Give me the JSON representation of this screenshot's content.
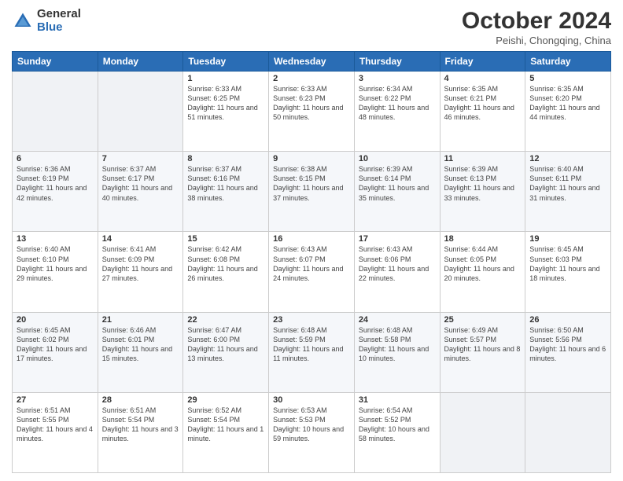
{
  "logo": {
    "general": "General",
    "blue": "Blue"
  },
  "header": {
    "month": "October 2024",
    "location": "Peishi, Chongqing, China"
  },
  "days_of_week": [
    "Sunday",
    "Monday",
    "Tuesday",
    "Wednesday",
    "Thursday",
    "Friday",
    "Saturday"
  ],
  "weeks": [
    [
      {
        "day": "",
        "empty": true
      },
      {
        "day": "",
        "empty": true
      },
      {
        "day": "1",
        "sunrise": "6:33 AM",
        "sunset": "6:25 PM",
        "daylight": "11 hours and 51 minutes."
      },
      {
        "day": "2",
        "sunrise": "6:33 AM",
        "sunset": "6:23 PM",
        "daylight": "11 hours and 50 minutes."
      },
      {
        "day": "3",
        "sunrise": "6:34 AM",
        "sunset": "6:22 PM",
        "daylight": "11 hours and 48 minutes."
      },
      {
        "day": "4",
        "sunrise": "6:35 AM",
        "sunset": "6:21 PM",
        "daylight": "11 hours and 46 minutes."
      },
      {
        "day": "5",
        "sunrise": "6:35 AM",
        "sunset": "6:20 PM",
        "daylight": "11 hours and 44 minutes."
      }
    ],
    [
      {
        "day": "6",
        "sunrise": "6:36 AM",
        "sunset": "6:19 PM",
        "daylight": "11 hours and 42 minutes."
      },
      {
        "day": "7",
        "sunrise": "6:37 AM",
        "sunset": "6:17 PM",
        "daylight": "11 hours and 40 minutes."
      },
      {
        "day": "8",
        "sunrise": "6:37 AM",
        "sunset": "6:16 PM",
        "daylight": "11 hours and 38 minutes."
      },
      {
        "day": "9",
        "sunrise": "6:38 AM",
        "sunset": "6:15 PM",
        "daylight": "11 hours and 37 minutes."
      },
      {
        "day": "10",
        "sunrise": "6:39 AM",
        "sunset": "6:14 PM",
        "daylight": "11 hours and 35 minutes."
      },
      {
        "day": "11",
        "sunrise": "6:39 AM",
        "sunset": "6:13 PM",
        "daylight": "11 hours and 33 minutes."
      },
      {
        "day": "12",
        "sunrise": "6:40 AM",
        "sunset": "6:11 PM",
        "daylight": "11 hours and 31 minutes."
      }
    ],
    [
      {
        "day": "13",
        "sunrise": "6:40 AM",
        "sunset": "6:10 PM",
        "daylight": "11 hours and 29 minutes."
      },
      {
        "day": "14",
        "sunrise": "6:41 AM",
        "sunset": "6:09 PM",
        "daylight": "11 hours and 27 minutes."
      },
      {
        "day": "15",
        "sunrise": "6:42 AM",
        "sunset": "6:08 PM",
        "daylight": "11 hours and 26 minutes."
      },
      {
        "day": "16",
        "sunrise": "6:43 AM",
        "sunset": "6:07 PM",
        "daylight": "11 hours and 24 minutes."
      },
      {
        "day": "17",
        "sunrise": "6:43 AM",
        "sunset": "6:06 PM",
        "daylight": "11 hours and 22 minutes."
      },
      {
        "day": "18",
        "sunrise": "6:44 AM",
        "sunset": "6:05 PM",
        "daylight": "11 hours and 20 minutes."
      },
      {
        "day": "19",
        "sunrise": "6:45 AM",
        "sunset": "6:03 PM",
        "daylight": "11 hours and 18 minutes."
      }
    ],
    [
      {
        "day": "20",
        "sunrise": "6:45 AM",
        "sunset": "6:02 PM",
        "daylight": "11 hours and 17 minutes."
      },
      {
        "day": "21",
        "sunrise": "6:46 AM",
        "sunset": "6:01 PM",
        "daylight": "11 hours and 15 minutes."
      },
      {
        "day": "22",
        "sunrise": "6:47 AM",
        "sunset": "6:00 PM",
        "daylight": "11 hours and 13 minutes."
      },
      {
        "day": "23",
        "sunrise": "6:48 AM",
        "sunset": "5:59 PM",
        "daylight": "11 hours and 11 minutes."
      },
      {
        "day": "24",
        "sunrise": "6:48 AM",
        "sunset": "5:58 PM",
        "daylight": "11 hours and 10 minutes."
      },
      {
        "day": "25",
        "sunrise": "6:49 AM",
        "sunset": "5:57 PM",
        "daylight": "11 hours and 8 minutes."
      },
      {
        "day": "26",
        "sunrise": "6:50 AM",
        "sunset": "5:56 PM",
        "daylight": "11 hours and 6 minutes."
      }
    ],
    [
      {
        "day": "27",
        "sunrise": "6:51 AM",
        "sunset": "5:55 PM",
        "daylight": "11 hours and 4 minutes."
      },
      {
        "day": "28",
        "sunrise": "6:51 AM",
        "sunset": "5:54 PM",
        "daylight": "11 hours and 3 minutes."
      },
      {
        "day": "29",
        "sunrise": "6:52 AM",
        "sunset": "5:54 PM",
        "daylight": "11 hours and 1 minute."
      },
      {
        "day": "30",
        "sunrise": "6:53 AM",
        "sunset": "5:53 PM",
        "daylight": "10 hours and 59 minutes."
      },
      {
        "day": "31",
        "sunrise": "6:54 AM",
        "sunset": "5:52 PM",
        "daylight": "10 hours and 58 minutes."
      },
      {
        "day": "",
        "empty": true
      },
      {
        "day": "",
        "empty": true
      }
    ]
  ],
  "labels": {
    "sunrise": "Sunrise:",
    "sunset": "Sunset:",
    "daylight": "Daylight:"
  }
}
